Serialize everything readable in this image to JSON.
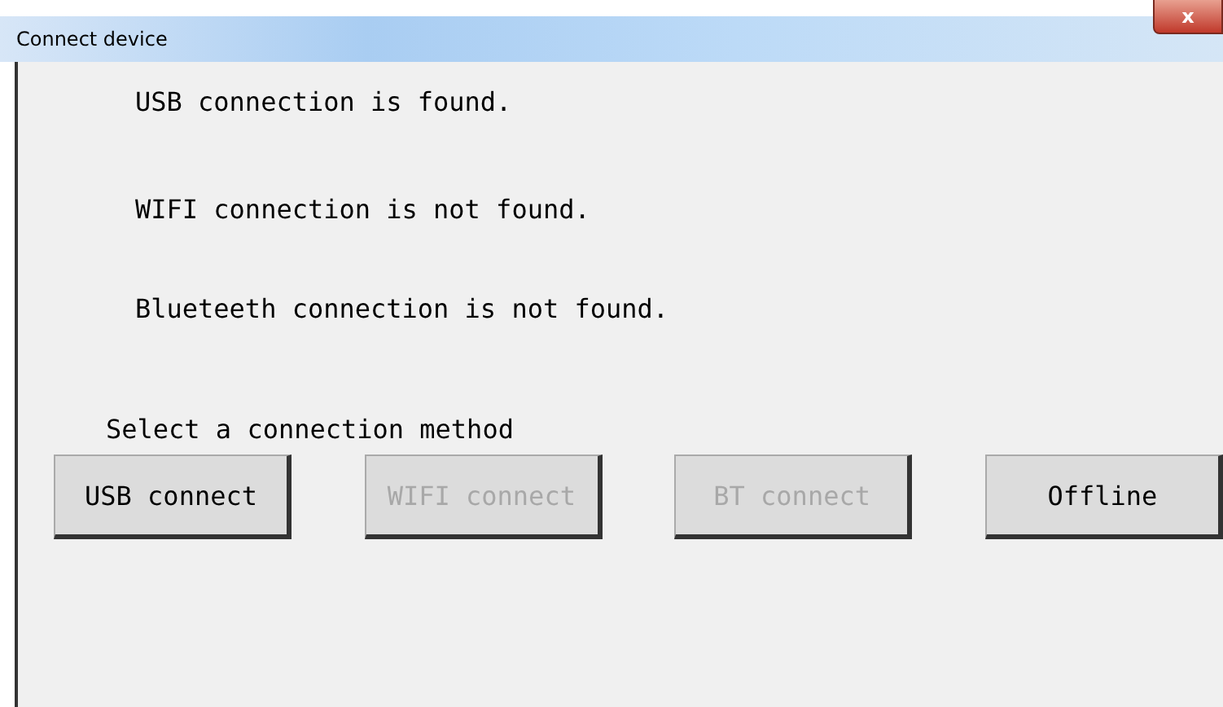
{
  "window": {
    "title": "Connect device",
    "close": "x"
  },
  "messages": [
    "USB connection is found.",
    "WIFI connection is not found.",
    "Blueteeth connection is not found."
  ],
  "prompt": "Select a connection method",
  "buttons": [
    {
      "label": "USB connect",
      "disabled": false
    },
    {
      "label": "WIFI connect",
      "disabled": true
    },
    {
      "label": "BT connect",
      "disabled": true
    },
    {
      "label": "Offline",
      "disabled": false
    }
  ]
}
